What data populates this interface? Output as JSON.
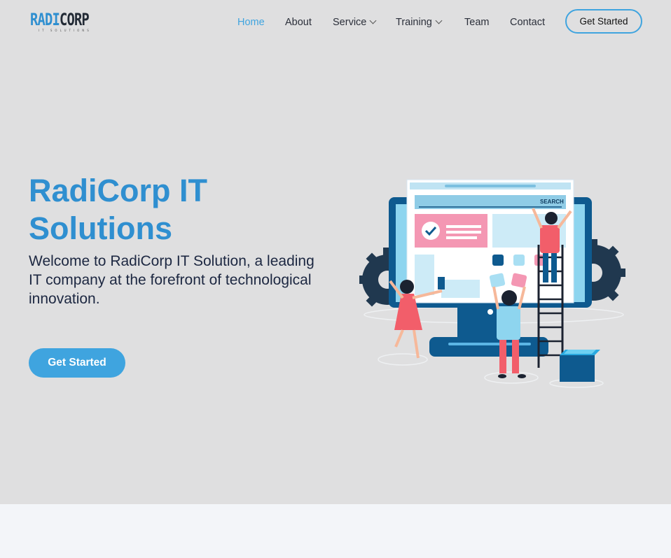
{
  "brand": {
    "logo_part1": "RADI",
    "logo_part2": "CORP",
    "logo_tagline": "IT SOLUTIONS"
  },
  "nav": {
    "items": [
      {
        "label": "Home",
        "active": true
      },
      {
        "label": "About"
      },
      {
        "label": "Service",
        "dropdown": true
      },
      {
        "label": "Training",
        "dropdown": true
      },
      {
        "label": "Team"
      },
      {
        "label": "Contact"
      }
    ],
    "cta_label": "Get Started"
  },
  "hero": {
    "title": "RadiCorp IT Solutions",
    "subtitle": "Welcome to RadiCorp IT Solution, a leading IT company at the forefront of technological innovation.",
    "cta_label": "Get Started",
    "illustration_search_label": "SEARCH"
  },
  "colors": {
    "accent": "#3fa4df",
    "title_blue": "#2f8fd0",
    "hero_bg": "#dfdfe0",
    "text_dark": "#1c2741"
  }
}
